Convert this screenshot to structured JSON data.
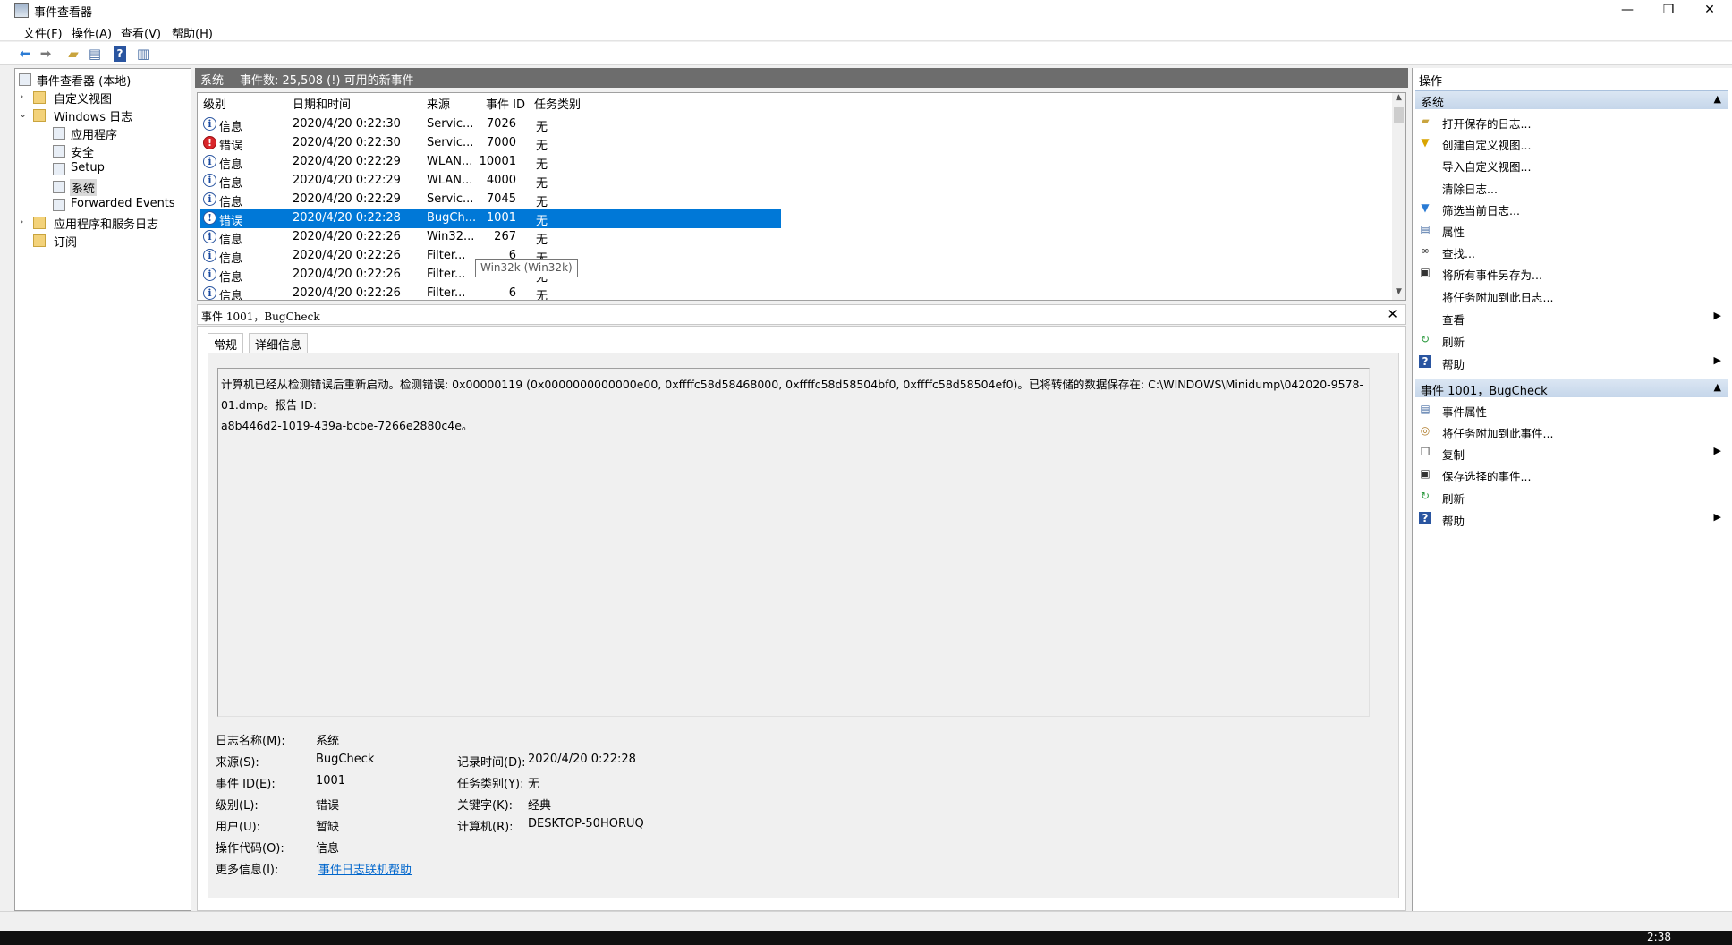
{
  "window": {
    "title": "事件查看器",
    "controls": [
      "—",
      "❐",
      "✕"
    ]
  },
  "menu": [
    "文件(F)",
    "操作(A)",
    "查看(V)",
    "帮助(H)"
  ],
  "toolbar": {
    "icons": [
      "back-arrow-icon",
      "forward-arrow-icon",
      "open-folder-icon",
      "show-hide-tree-icon",
      "help-icon",
      "properties-icon"
    ]
  },
  "tree": {
    "root": "事件查看器 (本地)",
    "custom_views": "自定义视图",
    "windows_logs": "Windows 日志",
    "logs": [
      "应用程序",
      "安全",
      "Setup",
      "系统",
      "Forwarded Events"
    ],
    "app_service_logs": "应用程序和服务日志",
    "subscriptions": "订阅"
  },
  "list_header": {
    "name": "系统",
    "count": "事件数: 25,508 (!) 可用的新事件"
  },
  "columns": [
    "级别",
    "日期和时间",
    "来源",
    "事件 ID",
    "任务类别"
  ],
  "rows": [
    {
      "level": "信息",
      "type": "info",
      "datetime": "2020/4/20 0:22:30",
      "source": "Servic...",
      "id": "7026",
      "task": "无"
    },
    {
      "level": "错误",
      "type": "error",
      "datetime": "2020/4/20 0:22:30",
      "source": "Servic...",
      "id": "7000",
      "task": "无"
    },
    {
      "level": "信息",
      "type": "info",
      "datetime": "2020/4/20 0:22:29",
      "source": "WLAN...",
      "id": "10001",
      "task": "无"
    },
    {
      "level": "信息",
      "type": "info",
      "datetime": "2020/4/20 0:22:29",
      "source": "WLAN...",
      "id": "4000",
      "task": "无"
    },
    {
      "level": "信息",
      "type": "info",
      "datetime": "2020/4/20 0:22:29",
      "source": "Servic...",
      "id": "7045",
      "task": "无"
    },
    {
      "level": "错误",
      "type": "error",
      "datetime": "2020/4/20 0:22:28",
      "source": "BugCh...",
      "id": "1001",
      "task": "无"
    },
    {
      "level": "信息",
      "type": "info",
      "datetime": "2020/4/20 0:22:26",
      "source": "Win32...",
      "id": "267",
      "task": "无"
    },
    {
      "level": "信息",
      "type": "info",
      "datetime": "2020/4/20 0:22:26",
      "source": "Filter...",
      "id": "6",
      "task": "无"
    },
    {
      "level": "信息",
      "type": "info",
      "datetime": "2020/4/20 0:22:26",
      "source": "Filter...",
      "id": "6",
      "task": "无"
    },
    {
      "level": "信息",
      "type": "info",
      "datetime": "2020/4/20 0:22:26",
      "source": "Filter...",
      "id": "6",
      "task": "无"
    }
  ],
  "tooltip": "Win32k (Win32k)",
  "detail": {
    "title": "事件 1001，BugCheck",
    "tabs": [
      "常规",
      "详细信息"
    ],
    "message_line1": "计算机已经从检测错误后重新启动。检测错误: 0x00000119 (0x0000000000000e00, 0xffffc58d58468000, 0xffffc58d58504bf0, 0xffffc58d58504ef0)。已将转储的数据保存在: C:\\WINDOWS\\Minidump\\042020-9578-01.dmp。报告 ID:",
    "message_line2": "a8b446d2-1019-439a-bcbe-7266e2880c4e。",
    "fields": {
      "log_name_label": "日志名称(M):",
      "log_name": "系统",
      "source_label": "来源(S):",
      "source": "BugCheck",
      "logged_label": "记录时间(D):",
      "logged": "2020/4/20 0:22:28",
      "event_id_label": "事件 ID(E):",
      "event_id": "1001",
      "task_label": "任务类别(Y):",
      "task": "无",
      "level_label": "级别(L):",
      "level": "错误",
      "keywords_label": "关键字(K):",
      "keywords": "经典",
      "user_label": "用户(U):",
      "user": "暂缺",
      "computer_label": "计算机(R):",
      "computer": "DESKTOP-50HORUQ",
      "opcode_label": "操作代码(O):",
      "opcode": "信息",
      "more_info_label": "更多信息(I):",
      "more_info": "事件日志联机帮助"
    }
  },
  "actions": {
    "header": "操作",
    "section1": "系统",
    "items1": [
      "打开保存的日志...",
      "创建自定义视图...",
      "导入自定义视图...",
      "清除日志...",
      "筛选当前日志...",
      "属性",
      "查找...",
      "将所有事件另存为...",
      "将任务附加到此日志...",
      "查看",
      "刷新",
      "帮助"
    ],
    "section2": "事件 1001，BugCheck",
    "items2": [
      "事件属性",
      "将任务附加到此事件...",
      "复制",
      "保存选择的事件...",
      "刷新",
      "帮助"
    ]
  },
  "taskbar": {
    "clock": "2:38"
  }
}
